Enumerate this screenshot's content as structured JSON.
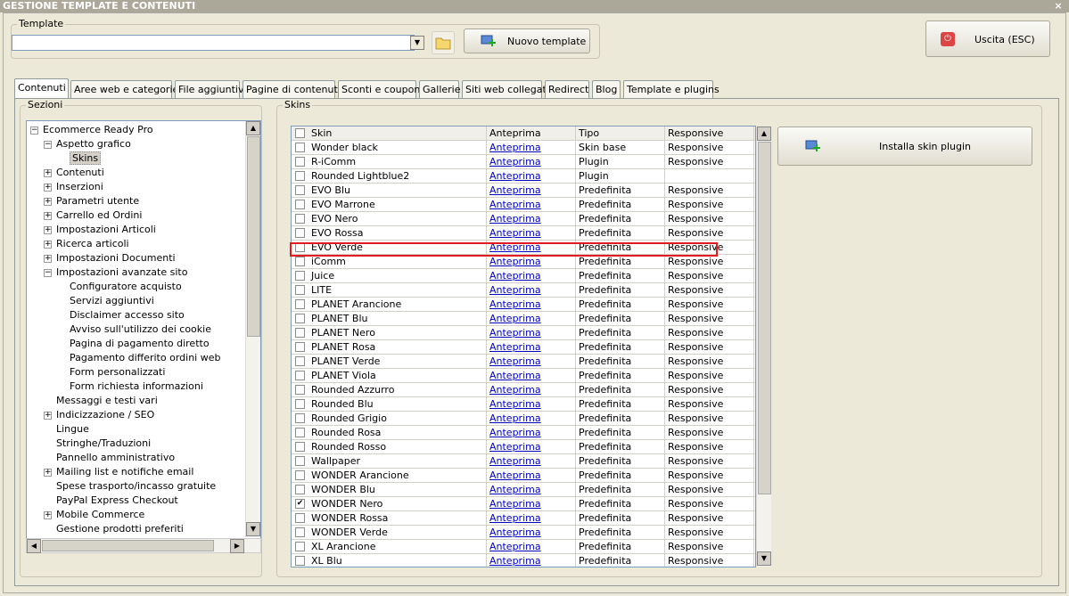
{
  "window": {
    "title": "GESTIONE TEMPLATE E CONTENUTI",
    "close_glyph": "×"
  },
  "template": {
    "group_label": "Template",
    "current_value": "",
    "new_button": "Nuovo template"
  },
  "exit_button": "Uscita (ESC)",
  "tabs": [
    "Contenuti",
    "Aree web e categorie",
    "File aggiuntivi",
    "Pagine di contenuti",
    "Sconti e coupon",
    "Gallerie",
    "Siti web collegati",
    "Redirect",
    "Blog",
    "Template e plugins"
  ],
  "active_tab": 0,
  "sections": {
    "label": "Sezioni",
    "tree": [
      {
        "label": "Ecommerce Ready Pro",
        "level": 0,
        "toggle": "−"
      },
      {
        "label": "Aspetto grafico",
        "level": 1,
        "toggle": "−"
      },
      {
        "label": "Skins",
        "level": 2,
        "toggle": "",
        "selected": true
      },
      {
        "label": "Contenuti",
        "level": 1,
        "toggle": "+"
      },
      {
        "label": "Inserzioni",
        "level": 1,
        "toggle": "+"
      },
      {
        "label": "Parametri utente",
        "level": 1,
        "toggle": "+"
      },
      {
        "label": "Carrello ed Ordini",
        "level": 1,
        "toggle": "+"
      },
      {
        "label": "Impostazioni Articoli",
        "level": 1,
        "toggle": "+"
      },
      {
        "label": "Ricerca articoli",
        "level": 1,
        "toggle": "+"
      },
      {
        "label": "Impostazioni Documenti",
        "level": 1,
        "toggle": "+"
      },
      {
        "label": "Impostazioni avanzate sito",
        "level": 1,
        "toggle": "−"
      },
      {
        "label": "Configuratore acquisto",
        "level": 2,
        "toggle": ""
      },
      {
        "label": "Servizi aggiuntivi",
        "level": 2,
        "toggle": ""
      },
      {
        "label": "Disclaimer accesso sito",
        "level": 2,
        "toggle": ""
      },
      {
        "label": "Avviso sull'utilizzo dei cookie",
        "level": 2,
        "toggle": ""
      },
      {
        "label": "Pagina di pagamento diretto",
        "level": 2,
        "toggle": ""
      },
      {
        "label": "Pagamento differito ordini web",
        "level": 2,
        "toggle": ""
      },
      {
        "label": "Form personalizzati",
        "level": 2,
        "toggle": ""
      },
      {
        "label": "Form richiesta informazioni",
        "level": 2,
        "toggle": ""
      },
      {
        "label": "Messaggi e testi vari",
        "level": 1,
        "toggle": ""
      },
      {
        "label": "Indicizzazione / SEO",
        "level": 1,
        "toggle": "+"
      },
      {
        "label": "Lingue",
        "level": 1,
        "toggle": ""
      },
      {
        "label": "Stringhe/Traduzioni",
        "level": 1,
        "toggle": ""
      },
      {
        "label": "Pannello amministrativo",
        "level": 1,
        "toggle": ""
      },
      {
        "label": "Mailing list e notifiche email",
        "level": 1,
        "toggle": "+"
      },
      {
        "label": "Spese trasporto/incasso gratuite",
        "level": 1,
        "toggle": ""
      },
      {
        "label": "PayPal Express Checkout",
        "level": 1,
        "toggle": ""
      },
      {
        "label": "Mobile Commerce",
        "level": 1,
        "toggle": "+"
      },
      {
        "label": "Gestione prodotti preferiti",
        "level": 1,
        "toggle": ""
      }
    ]
  },
  "skins": {
    "label": "Skins",
    "install_button": "Installa skin plugin",
    "columns": [
      "Skin",
      "Anteprima",
      "Tipo",
      "Responsive"
    ],
    "rows": [
      {
        "checked": false,
        "skin": "Wonder black",
        "preview": "Anteprima",
        "type": "Skin base",
        "responsive": "Responsive"
      },
      {
        "checked": false,
        "skin": "R-iComm",
        "preview": "Anteprima",
        "type": "Plugin",
        "responsive": "Responsive"
      },
      {
        "checked": false,
        "skin": "Rounded Lightblue2",
        "preview": "Anteprima",
        "type": "Plugin",
        "responsive": ""
      },
      {
        "checked": false,
        "skin": "EVO Blu",
        "preview": "Anteprima",
        "type": "Predefinita",
        "responsive": "Responsive"
      },
      {
        "checked": false,
        "skin": "EVO Marrone",
        "preview": "Anteprima",
        "type": "Predefinita",
        "responsive": "Responsive"
      },
      {
        "checked": false,
        "skin": "EVO Nero",
        "preview": "Anteprima",
        "type": "Predefinita",
        "responsive": "Responsive"
      },
      {
        "checked": false,
        "skin": "EVO Rossa",
        "preview": "Anteprima",
        "type": "Predefinita",
        "responsive": "Responsive"
      },
      {
        "checked": false,
        "skin": "EVO Verde",
        "preview": "Anteprima",
        "type": "Predefinita",
        "responsive": "Responsive"
      },
      {
        "checked": false,
        "skin": "iComm",
        "preview": "Anteprima",
        "type": "Predefinita",
        "responsive": "Responsive"
      },
      {
        "checked": false,
        "skin": "Juice",
        "preview": "Anteprima",
        "type": "Predefinita",
        "responsive": "Responsive"
      },
      {
        "checked": false,
        "skin": "LITE",
        "preview": "Anteprima",
        "type": "Predefinita",
        "responsive": "Responsive"
      },
      {
        "checked": false,
        "skin": "PLANET Arancione",
        "preview": "Anteprima",
        "type": "Predefinita",
        "responsive": "Responsive"
      },
      {
        "checked": false,
        "skin": "PLANET Blu",
        "preview": "Anteprima",
        "type": "Predefinita",
        "responsive": "Responsive"
      },
      {
        "checked": false,
        "skin": "PLANET Nero",
        "preview": "Anteprima",
        "type": "Predefinita",
        "responsive": "Responsive"
      },
      {
        "checked": false,
        "skin": "PLANET Rosa",
        "preview": "Anteprima",
        "type": "Predefinita",
        "responsive": "Responsive"
      },
      {
        "checked": false,
        "skin": "PLANET Verde",
        "preview": "Anteprima",
        "type": "Predefinita",
        "responsive": "Responsive"
      },
      {
        "checked": false,
        "skin": "PLANET Viola",
        "preview": "Anteprima",
        "type": "Predefinita",
        "responsive": "Responsive"
      },
      {
        "checked": false,
        "skin": "Rounded Azzurro",
        "preview": "Anteprima",
        "type": "Predefinita",
        "responsive": "Responsive"
      },
      {
        "checked": false,
        "skin": "Rounded Blu",
        "preview": "Anteprima",
        "type": "Predefinita",
        "responsive": "Responsive"
      },
      {
        "checked": false,
        "skin": "Rounded Grigio",
        "preview": "Anteprima",
        "type": "Predefinita",
        "responsive": "Responsive"
      },
      {
        "checked": false,
        "skin": "Rounded Rosa",
        "preview": "Anteprima",
        "type": "Predefinita",
        "responsive": "Responsive"
      },
      {
        "checked": false,
        "skin": "Rounded Rosso",
        "preview": "Anteprima",
        "type": "Predefinita",
        "responsive": "Responsive"
      },
      {
        "checked": false,
        "skin": "Wallpaper",
        "preview": "Anteprima",
        "type": "Predefinita",
        "responsive": "Responsive"
      },
      {
        "checked": false,
        "skin": "WONDER Arancione",
        "preview": "Anteprima",
        "type": "Predefinita",
        "responsive": "Responsive"
      },
      {
        "checked": false,
        "skin": "WONDER Blu",
        "preview": "Anteprima",
        "type": "Predefinita",
        "responsive": "Responsive"
      },
      {
        "checked": true,
        "skin": "WONDER Nero",
        "preview": "Anteprima",
        "type": "Predefinita",
        "responsive": "Responsive"
      },
      {
        "checked": false,
        "skin": "WONDER Rossa",
        "preview": "Anteprima",
        "type": "Predefinita",
        "responsive": "Responsive"
      },
      {
        "checked": false,
        "skin": "WONDER Verde",
        "preview": "Anteprima",
        "type": "Predefinita",
        "responsive": "Responsive"
      },
      {
        "checked": false,
        "skin": "XL Arancione",
        "preview": "Anteprima",
        "type": "Predefinita",
        "responsive": "Responsive"
      },
      {
        "checked": false,
        "skin": "XL Blu",
        "preview": "Anteprima",
        "type": "Predefinita",
        "responsive": "Responsive"
      }
    ]
  },
  "colors": {
    "highlight": "#e21b23",
    "link": "#0000cc",
    "selected_bg": "#316ac5"
  }
}
